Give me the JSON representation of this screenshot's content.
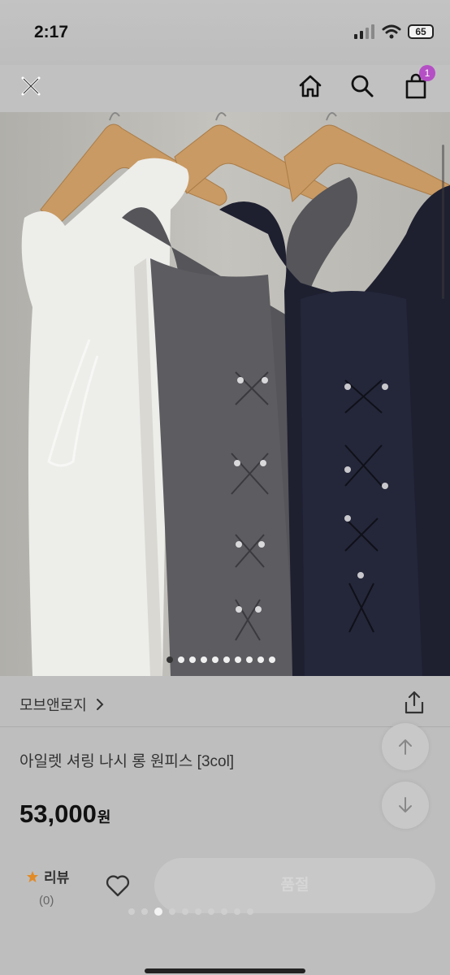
{
  "status_bar": {
    "time": "2:17",
    "battery": "65"
  },
  "nav": {
    "cart_badge": "1"
  },
  "image": {
    "dots_total": 10,
    "dots_active_index": 0
  },
  "product": {
    "brand": "모브앤로지",
    "title": "아일렛 셔링 나시 롱 원피스 [3col]",
    "price": "53,000",
    "currency": "원"
  },
  "bottom": {
    "review_label": "리뷰",
    "review_count": "(0)",
    "soldout_label": "품절"
  },
  "colors": {
    "badge": "#b54fc5",
    "star": "#e28a25",
    "dress_white": "#ededea",
    "dress_gray": "#55555a",
    "dress_navy": "#1e2030",
    "hanger": "#c99a63"
  }
}
